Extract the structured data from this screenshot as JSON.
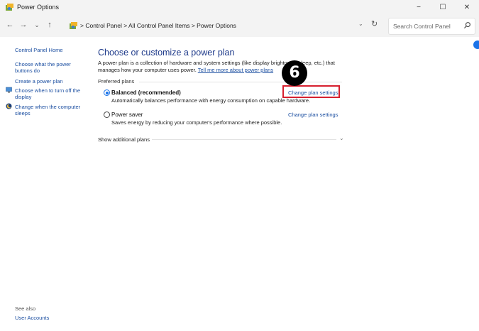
{
  "window": {
    "title": "Power Options",
    "minimize": "−",
    "maximize": "☐",
    "close": "✕"
  },
  "nav": {
    "back": "←",
    "forward": "→",
    "recent": "⌄",
    "up": "↑",
    "path": "> Control Panel > All Control Panel Items > Power Options",
    "dropdown": "⌄",
    "refresh": "↻",
    "search_placeholder": "Search Control Panel"
  },
  "sidebar": {
    "home": "Control Panel Home",
    "items": [
      "Choose what the power buttons do",
      "Create a power plan",
      "Choose when to turn off the display",
      "Change when the computer sleeps"
    ],
    "see_also": "See also",
    "user_accounts": "User Accounts"
  },
  "main": {
    "title": "Choose or customize a power plan",
    "description": "A power plan is a collection of hardware and system settings (like display brightness, sleep, etc.) that manages how your computer uses power.",
    "tell_more": "Tell me more about power plans",
    "preferred_label": "Preferred plans",
    "plans": [
      {
        "name": "Balanced (recommended)",
        "selected": true,
        "description": "Automatically balances performance with energy consumption on capable hardware.",
        "link": "Change plan settings"
      },
      {
        "name": "Power saver",
        "selected": false,
        "description": "Saves energy by reducing your computer's performance where possible.",
        "link": "Change plan settings"
      }
    ],
    "show_additional": "Show additional plans"
  },
  "callout": {
    "number": "6",
    "color": "#d6202f"
  }
}
